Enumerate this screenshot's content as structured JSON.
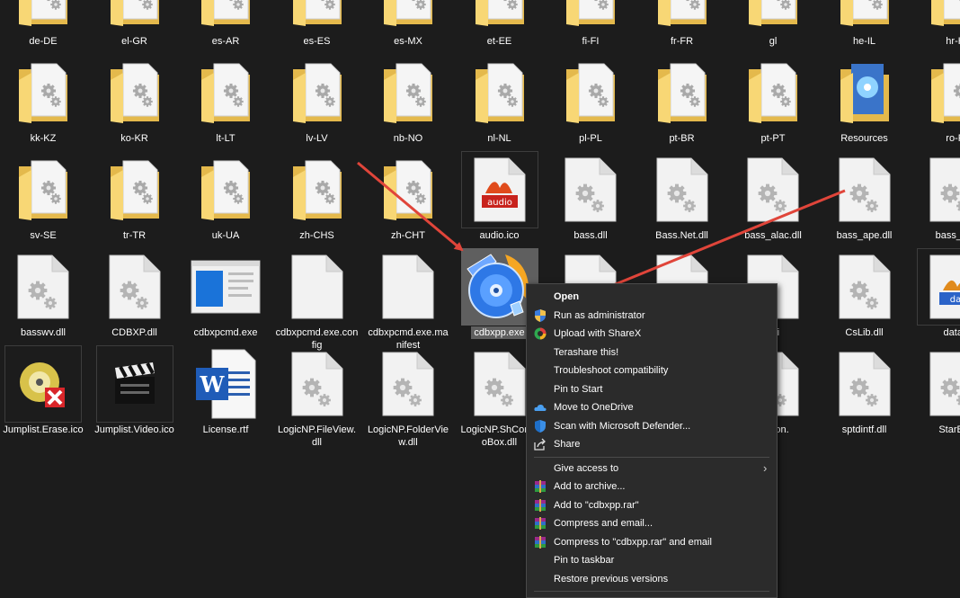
{
  "colors": {
    "background": "#1c1c1c",
    "folder": "#f8d775",
    "folder_dark": "#e4b94c",
    "menu_bg": "#2b2b2b",
    "annotation_arrow": "#e0453a",
    "selected": "#5f5f5f"
  },
  "files": [
    {
      "label": "de-DE",
      "icon": "folder-icon"
    },
    {
      "label": "el-GR",
      "icon": "folder-icon"
    },
    {
      "label": "es-AR",
      "icon": "folder-icon"
    },
    {
      "label": "es-ES",
      "icon": "folder-icon"
    },
    {
      "label": "es-MX",
      "icon": "folder-icon"
    },
    {
      "label": "et-EE",
      "icon": "folder-icon"
    },
    {
      "label": "fi-FI",
      "icon": "folder-icon"
    },
    {
      "label": "fr-FR",
      "icon": "folder-icon"
    },
    {
      "label": "gl",
      "icon": "folder-icon"
    },
    {
      "label": "he-IL",
      "icon": "folder-icon"
    },
    {
      "label": "hr-H",
      "icon": "folder-icon"
    },
    {
      "label": "kk-KZ",
      "icon": "folder-icon"
    },
    {
      "label": "ko-KR",
      "icon": "folder-icon"
    },
    {
      "label": "lt-LT",
      "icon": "folder-icon"
    },
    {
      "label": "lv-LV",
      "icon": "folder-icon"
    },
    {
      "label": "nb-NO",
      "icon": "folder-icon"
    },
    {
      "label": "nl-NL",
      "icon": "folder-icon"
    },
    {
      "label": "pl-PL",
      "icon": "folder-icon"
    },
    {
      "label": "pt-BR",
      "icon": "folder-icon"
    },
    {
      "label": "pt-PT",
      "icon": "folder-icon"
    },
    {
      "label": "Resources",
      "icon": "resources-folder-icon"
    },
    {
      "label": "ro-R",
      "icon": "folder-icon"
    },
    {
      "label": "sv-SE",
      "icon": "folder-icon"
    },
    {
      "label": "tr-TR",
      "icon": "folder-icon"
    },
    {
      "label": "uk-UA",
      "icon": "folder-icon"
    },
    {
      "label": "zh-CHS",
      "icon": "folder-icon"
    },
    {
      "label": "zh-CHT",
      "icon": "folder-icon"
    },
    {
      "label": "audio.ico",
      "icon": "audio-file-icon",
      "framed": true
    },
    {
      "label": "bass.dll",
      "icon": "dll-file-icon"
    },
    {
      "label": "Bass.Net.dll",
      "icon": "dll-file-icon"
    },
    {
      "label": "bass_alac.dll",
      "icon": "dll-file-icon"
    },
    {
      "label": "bass_ape.dll",
      "icon": "dll-file-icon"
    },
    {
      "label": "bass_mp",
      "icon": "dll-file-icon"
    },
    {
      "label": "basswv.dll",
      "icon": "dll-file-icon"
    },
    {
      "label": "CDBXP.dll",
      "icon": "dll-file-icon"
    },
    {
      "label": "cdbxpcmd.exe",
      "icon": "window-exe-icon"
    },
    {
      "label": "cdbxpcmd.exe.config",
      "icon": "blank-file-icon"
    },
    {
      "label": "cdbxpcmd.exe.manifest",
      "icon": "blank-file-icon"
    },
    {
      "label": "cdbxpp.exe",
      "icon": "cdbxp-app-icon",
      "selected": true
    },
    {
      "label": "",
      "icon": "blank-file-icon"
    },
    {
      "label": "",
      "icon": "blank-file-icon"
    },
    {
      "label": ".ini",
      "icon": "blank-file-icon"
    },
    {
      "label": "CsLib.dll",
      "icon": "dll-file-icon"
    },
    {
      "label": "data.i",
      "icon": "data-file-icon",
      "framed": true
    },
    {
      "label": "Jumplist.Erase.ico",
      "icon": "erase-disc-icon",
      "framed": true
    },
    {
      "label": "Jumplist.Video.ico",
      "icon": "video-clapper-icon",
      "framed": true
    },
    {
      "label": "License.rtf",
      "icon": "word-doc-icon"
    },
    {
      "label": "LogicNP.FileView.dll",
      "icon": "dll-file-icon"
    },
    {
      "label": "LogicNP.FolderView.dll",
      "icon": "dll-file-icon"
    },
    {
      "label": "LogicNP.ShComboBox.dll",
      "icon": "dll-file-icon"
    },
    {
      "label": "",
      "icon": "none"
    },
    {
      "label": "",
      "icon": "none"
    },
    {
      "label": "ft.Json.",
      "icon": "dll-file-icon"
    },
    {
      "label": "sptdintf.dll",
      "icon": "dll-file-icon"
    },
    {
      "label": "StarBur",
      "icon": "dll-file-icon"
    }
  ],
  "context_menu": {
    "items": [
      {
        "label": "Open",
        "icon": "none",
        "bold": true
      },
      {
        "label": "Run as administrator",
        "icon": "uac-shield-icon"
      },
      {
        "label": "Upload with ShareX",
        "icon": "sharex-icon"
      },
      {
        "label": "Terashare this!",
        "icon": "none"
      },
      {
        "label": "Troubleshoot compatibility",
        "icon": "none"
      },
      {
        "label": "Pin to Start",
        "icon": "none"
      },
      {
        "label": "Move to OneDrive",
        "icon": "onedrive-icon"
      },
      {
        "label": "Scan with Microsoft Defender...",
        "icon": "defender-icon"
      },
      {
        "label": "Share",
        "icon": "share-icon"
      },
      {
        "separator": true
      },
      {
        "label": "Give access to",
        "icon": "none",
        "submenu": true
      },
      {
        "label": "Add to archive...",
        "icon": "winrar-icon"
      },
      {
        "label": "Add to \"cdbxpp.rar\"",
        "icon": "winrar-icon"
      },
      {
        "label": "Compress and email...",
        "icon": "winrar-icon"
      },
      {
        "label": "Compress to \"cdbxpp.rar\" and email",
        "icon": "winrar-icon"
      },
      {
        "label": "Pin to taskbar",
        "icon": "none"
      },
      {
        "label": "Restore previous versions",
        "icon": "none"
      },
      {
        "separator": true
      }
    ]
  }
}
